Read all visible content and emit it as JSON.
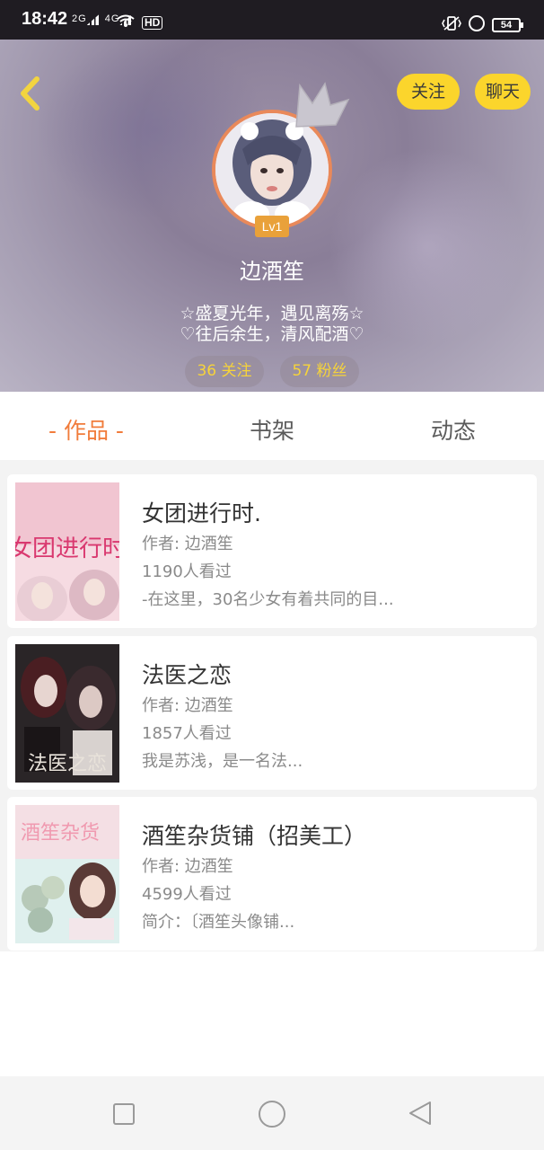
{
  "status_bar": {
    "time": "18:42",
    "network_1": "2G",
    "network_2": "4G",
    "hd_label": "HD",
    "battery": "54",
    "icons": [
      "signal-icon",
      "wifi-icon",
      "vibrate-icon",
      "alarm-icon",
      "battery-icon"
    ]
  },
  "header": {
    "follow_label": "关注",
    "chat_label": "聊天",
    "level": "Lv1",
    "username": "边酒笙",
    "bio_line_1": "☆盛夏光年，遇见离殇☆",
    "bio_line_2": "♡往后余生，清风配酒♡",
    "following": "36 关注",
    "fans": "57 粉丝",
    "accent_color": "#fbd52c"
  },
  "tabs": [
    {
      "label": "- 作品 -",
      "active": true
    },
    {
      "label": "书架",
      "active": false
    },
    {
      "label": "动态",
      "active": false
    }
  ],
  "books": [
    {
      "title": "女团进行时.",
      "author": "作者: 边酒笙",
      "views": "1190人看过",
      "intro": "-在这里，30名少女有着共同的目...",
      "cover_text": "女团进行时"
    },
    {
      "title": "法医之恋",
      "author": "作者: 边酒笙",
      "views": "1857人看过",
      "intro": "我是苏浅，是一名法...",
      "cover_text": "法医之恋"
    },
    {
      "title": "酒笙杂货铺（招美工）",
      "author": "作者: 边酒笙",
      "views": "4599人看过",
      "intro": "简介：〔酒笙头像铺...",
      "cover_text": "酒笙杂货"
    }
  ],
  "colors": {
    "active_tab": "#f17c3b",
    "avatar_border": "#e9895a",
    "level_badge": "#e9a13a",
    "stat_text": "#f6d33a"
  }
}
